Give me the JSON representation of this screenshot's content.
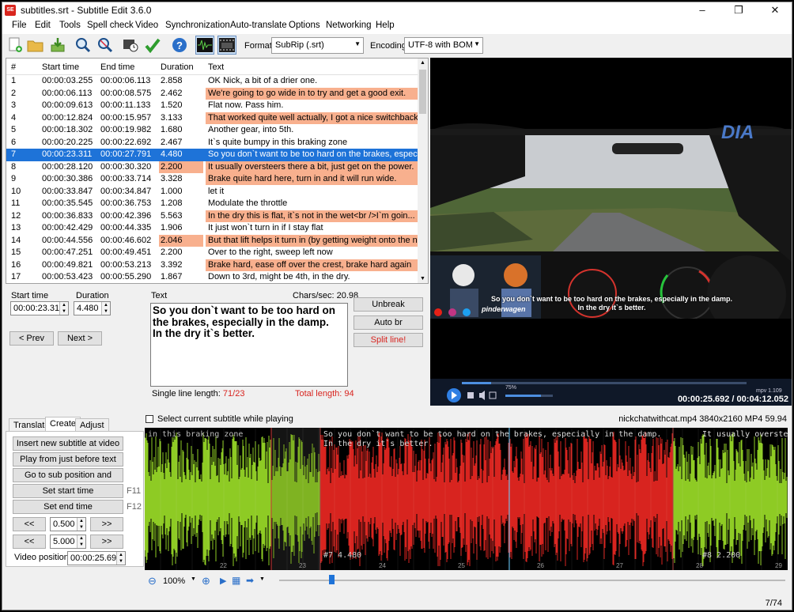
{
  "window": {
    "title": "subtitles.srt - Subtitle Edit 3.6.0",
    "icon_text": "SE"
  },
  "menu": [
    "File",
    "Edit",
    "Tools",
    "Spell check",
    "Video",
    "Synchronization",
    "Auto-translate",
    "Options",
    "Networking",
    "Help"
  ],
  "toolbar": {
    "format_label": "Format",
    "format_value": "SubRip (.srt)",
    "encoding_label": "Encoding",
    "encoding_value": "UTF-8 with BOM"
  },
  "grid": {
    "columns": [
      "#",
      "Start time",
      "End time",
      "Duration",
      "Text"
    ],
    "rows": [
      {
        "n": "1",
        "start": "00:00:03.255",
        "end": "00:00:06.113",
        "dur": "2.858",
        "text": "OK Nick, a bit of a drier one."
      },
      {
        "n": "2",
        "start": "00:00:06.113",
        "end": "00:00:08.575",
        "dur": "2.462",
        "text": "We're going to go wide in to try and get a good exit."
      },
      {
        "n": "3",
        "start": "00:00:09.613",
        "end": "00:00:11.133",
        "dur": "1.520",
        "text": "Flat now. Pass him."
      },
      {
        "n": "4",
        "start": "00:00:12.824",
        "end": "00:00:15.957",
        "dur": "3.133",
        "text": "That worked quite well actually, I got a nice switchback ..."
      },
      {
        "n": "5",
        "start": "00:00:18.302",
        "end": "00:00:19.982",
        "dur": "1.680",
        "text": "Another gear, into 5th."
      },
      {
        "n": "6",
        "start": "00:00:20.225",
        "end": "00:00:22.692",
        "dur": "2.467",
        "text": "It`s quite bumpy in this braking zone"
      },
      {
        "n": "7",
        "start": "00:00:23.311",
        "end": "00:00:27.791",
        "dur": "4.480",
        "text": "So you don`t want to be too hard on the brakes, especi"
      },
      {
        "n": "8",
        "start": "00:00:28.120",
        "end": "00:00:30.320",
        "dur": "2.200",
        "text": "It usually oversteers there a bit, just get on the power."
      },
      {
        "n": "9",
        "start": "00:00:30.386",
        "end": "00:00:33.714",
        "dur": "3.328",
        "text": "Brake quite hard here, turn in and it will run wide."
      },
      {
        "n": "10",
        "start": "00:00:33.847",
        "end": "00:00:34.847",
        "dur": "1.000",
        "text": "let it"
      },
      {
        "n": "11",
        "start": "00:00:35.545",
        "end": "00:00:36.753",
        "dur": "1.208",
        "text": "Modulate the throttle"
      },
      {
        "n": "12",
        "start": "00:00:36.833",
        "end": "00:00:42.396",
        "dur": "5.563",
        "text": "In the dry this is flat, it`s not in the wet<br />I`m goin..."
      },
      {
        "n": "13",
        "start": "00:00:42.429",
        "end": "00:00:44.335",
        "dur": "1.906",
        "text": "It just won`t turn in if I stay flat"
      },
      {
        "n": "14",
        "start": "00:00:44.556",
        "end": "00:00:46.602",
        "dur": "2.046",
        "text": "But that lift helps it turn in (by getting weight onto the n..."
      },
      {
        "n": "15",
        "start": "00:00:47.251",
        "end": "00:00:49.451",
        "dur": "2.200",
        "text": "Over to the right, sweep left now"
      },
      {
        "n": "16",
        "start": "00:00:49.821",
        "end": "00:00:53.213",
        "dur": "3.392",
        "text": "Brake hard, ease off over the crest, brake hard again"
      },
      {
        "n": "17",
        "start": "00:00:53.423",
        "end": "00:00:55.290",
        "dur": "1.867",
        "text": "Down to 3rd, might be 4th, in the dry."
      }
    ]
  },
  "editor": {
    "start_label": "Start time",
    "start_value": "00:00:23.311",
    "duration_label": "Duration",
    "duration_value": "4.480",
    "text_label": "Text",
    "chars_sec": "Chars/sec: 20.98",
    "text": "So you don`t want to be too hard on\nthe brakes, especially in the damp.\nIn the dry it`s better.",
    "single_line_label": "Single line length: ",
    "single_line_value": "71/23",
    "total_length": "Total length: 94",
    "prev": "< Prev",
    "next": "Next >",
    "unbreak": "Unbreak",
    "autobr": "Auto br",
    "split": "Split line!"
  },
  "video": {
    "subtitle": "So you don`t want to be too hard on the brakes, especially in the damp.\nIn the dry it`s better.",
    "channel": "pinderwagen",
    "logo": "DIAfast",
    "time": "00:00:25.692 / 00:04:12.052",
    "volume": "75%",
    "player": "mpv 1.109",
    "progress": 0.102
  },
  "bottom": {
    "tabs": [
      "Translate",
      "Create",
      "Adjust"
    ],
    "buttons": {
      "insert": "Insert new subtitle at video pos",
      "play": "Play from just before text",
      "goto": "Go to sub position and pause",
      "set_start": "Set start time",
      "set_end": "Set end time"
    },
    "f11": "F11",
    "f12": "F12",
    "step1": "0.500",
    "step2": "5.000",
    "back": "<<",
    "fwd": ">>",
    "video_pos_label": "Video position:",
    "video_pos": "00:00:25.692",
    "select_current": "Select current subtitle while playing",
    "file_info": "nickchatwithcat.mp4 3840x2160 MP4 59.94",
    "zoom": "100%"
  },
  "waveform": {
    "labels": [
      {
        "id": "s6",
        "text": "in this braking zone"
      },
      {
        "id": "s7",
        "text": "So you don`t want to be too hard on the brakes, especially in the damp.\nIn the dry it`s better."
      },
      {
        "id": "s8",
        "text": "It usually oversteers t"
      }
    ],
    "tag7": "#7  4.480",
    "tag8": "#8  2.200",
    "ticks": [
      "22",
      "23",
      "24",
      "25",
      "26",
      "27",
      "28",
      "29"
    ],
    "colors": {
      "active": "#d8241f",
      "other": "#8ecb24",
      "gap": "#0a0a0a"
    }
  },
  "status": "7/74"
}
